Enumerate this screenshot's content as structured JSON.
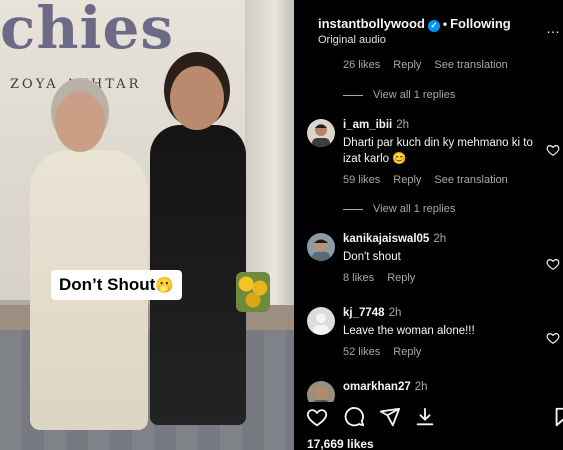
{
  "media": {
    "brand_title": "chies",
    "brand_subtitle": "ZOYA AKHTAR",
    "caption_text": "Don’t Shout",
    "caption_emoji": "🫢"
  },
  "header": {
    "username": "instantbollywood",
    "verified_icon": "verified-badge-icon",
    "separator": "•",
    "follow_label": "Following",
    "audio_label": "Original audio",
    "more_icon": "..."
  },
  "comments_panel": {
    "top_meta": {
      "likes": "26 likes",
      "reply": "Reply",
      "translate": "See translation"
    },
    "top_view_replies": "View all 1 replies",
    "comments": [
      {
        "username": "i_am_ibii",
        "time": "2h",
        "text": "Dharti par kuch din ky mehmano ki to izat karlo 😊",
        "likes": "59 likes",
        "reply": "Reply",
        "translate": "See translation",
        "view_replies": "View all 1 replies"
      },
      {
        "username": "kanikajaiswal05",
        "time": "2h",
        "text": "Don't shout",
        "likes": "8 likes",
        "reply": "Reply"
      },
      {
        "username": "kj_7748",
        "time": "2h",
        "text": "Leave the woman alone!!!",
        "likes": "52 likes",
        "reply": "Reply"
      },
      {
        "username": "omarkhan27",
        "time": "2h"
      }
    ]
  },
  "actions": {
    "like_icon": "heart-icon",
    "comment_icon": "comment-icon",
    "share_icon": "share-icon",
    "save_icon": "bookmark-icon",
    "likes_total": "17,669 likes"
  },
  "colors": {
    "background": "#000000",
    "text_primary": "#f5f5f5",
    "text_secondary": "#a8a8a8",
    "verified_blue": "#0095f6"
  }
}
